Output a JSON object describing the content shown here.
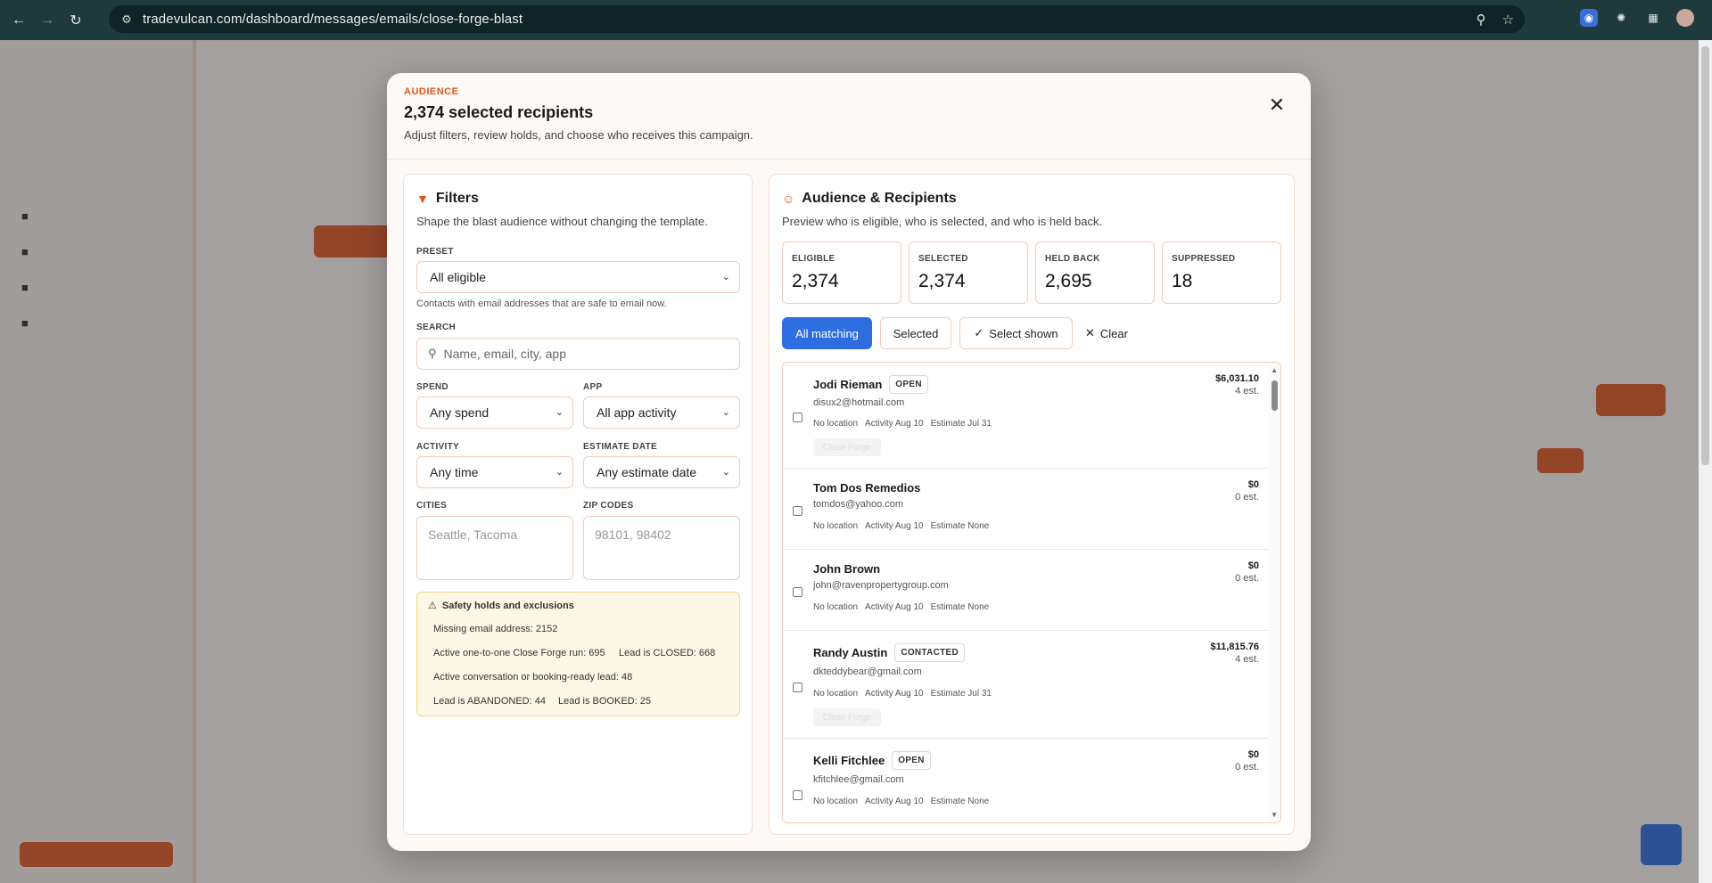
{
  "browser": {
    "url": "tradevulcan.com/dashboard/messages/emails/close-forge-blast"
  },
  "modal": {
    "kicker": "AUDIENCE",
    "title": "2,374 selected recipients",
    "subtitle": "Adjust filters, review holds, and choose who receives this campaign."
  },
  "filters": {
    "heading": "Filters",
    "description": "Shape the blast audience without changing the template.",
    "preset_label": "PRESET",
    "preset_value": "All eligible",
    "preset_hint": "Contacts with email addresses that are safe to email now.",
    "search_label": "SEARCH",
    "search_placeholder": "Name, email, city, app",
    "spend_label": "SPEND",
    "spend_value": "Any spend",
    "app_label": "APP",
    "app_value": "All app activity",
    "activity_label": "ACTIVITY",
    "activity_value": "Any time",
    "estimate_label": "ESTIMATE DATE",
    "estimate_value": "Any estimate date",
    "cities_label": "CITIES",
    "cities_placeholder": "Seattle, Tacoma",
    "zip_label": "ZIP CODES",
    "zip_placeholder": "98101, 98402"
  },
  "holds": {
    "title": "Safety holds and exclusions",
    "items": [
      "Missing email address: 2152",
      "Active one-to-one Close Forge run: 695",
      "Lead is CLOSED: 668",
      "Active conversation or booking-ready lead: 48",
      "Lead is ABANDONED: 44",
      "Lead is BOOKED: 25"
    ]
  },
  "audience": {
    "heading": "Audience & Recipients",
    "description": "Preview who is eligible, who is selected, and who is held back.",
    "stats": [
      {
        "label": "ELIGIBLE",
        "value": "2,374"
      },
      {
        "label": "SELECTED",
        "value": "2,374"
      },
      {
        "label": "HELD BACK",
        "value": "2,695"
      },
      {
        "label": "SUPPRESSED",
        "value": "18"
      }
    ],
    "buttons": {
      "all_matching": "All matching",
      "selected": "Selected",
      "select_shown": "Select shown",
      "clear": "Clear"
    },
    "recipients": [
      {
        "name": "Jodi Rieman",
        "badge": "OPEN",
        "email": "disux2@hotmail.com",
        "location": "No location",
        "activity": "Activity Aug 10",
        "estimate": "Estimate Jul 31",
        "amount": "$6,031.10",
        "est": "4 est.",
        "tag": "Close Forge"
      },
      {
        "name": "Tom Dos Remedios",
        "badge": "",
        "email": "tomdos@yahoo.com",
        "location": "No location",
        "activity": "Activity Aug 10",
        "estimate": "Estimate None",
        "amount": "$0",
        "est": "0 est.",
        "tag": ""
      },
      {
        "name": "John Brown",
        "badge": "",
        "email": "john@ravenpropertygroup.com",
        "location": "No location",
        "activity": "Activity Aug 10",
        "estimate": "Estimate None",
        "amount": "$0",
        "est": "0 est.",
        "tag": ""
      },
      {
        "name": "Randy Austin",
        "badge": "CONTACTED",
        "email": "dkteddybear@gmail.com",
        "location": "No location",
        "activity": "Activity Aug 10",
        "estimate": "Estimate Jul 31",
        "amount": "$11,815.76",
        "est": "4 est.",
        "tag": "Close Forge"
      },
      {
        "name": "Kelli Fitchlee",
        "badge": "OPEN",
        "email": "kfitchlee@gmail.com",
        "location": "No location",
        "activity": "Activity Aug 10",
        "estimate": "Estimate None",
        "amount": "$0",
        "est": "0 est.",
        "tag": ""
      }
    ]
  },
  "colors": {
    "accent": "#e0541c",
    "primary_button": "#2e6de0",
    "hold_bg": "#fdf8e5"
  }
}
